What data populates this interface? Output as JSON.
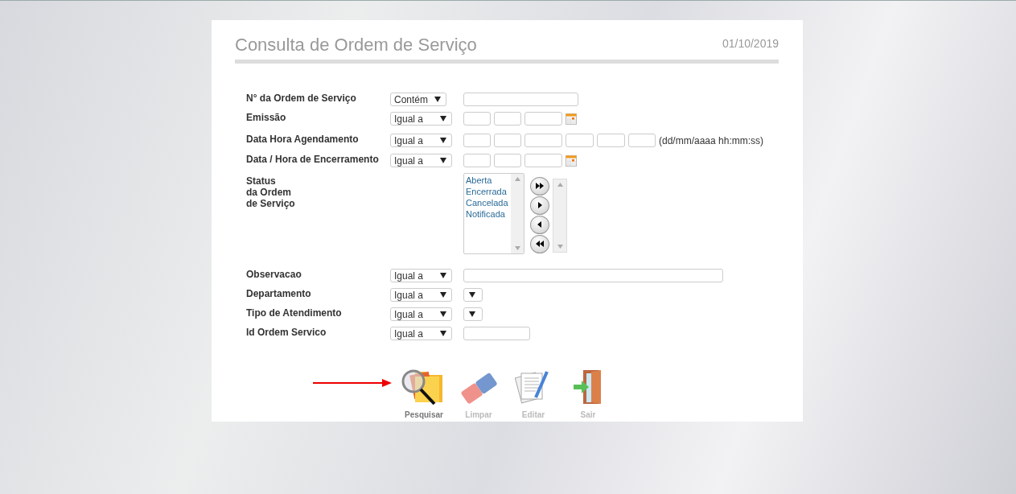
{
  "page": {
    "title": "Consulta de Ordem de Serviço",
    "date": "01/10/2019"
  },
  "fields": [
    {
      "label": "N° da Ordem de Serviço",
      "operator": "Contém",
      "kind": "text"
    },
    {
      "label": "Emissão",
      "operator": "Igual a",
      "kind": "date"
    },
    {
      "label": "Data Hora Agendamento",
      "operator": "Igual a",
      "kind": "datetime",
      "hint": "(dd/mm/aaaa hh:mm:ss)"
    },
    {
      "label": "Data / Hora de Encerramento",
      "operator": "Igual a",
      "kind": "date"
    },
    {
      "label": "Status\nda Ordem\nde Serviço",
      "kind": "listbox",
      "options": [
        "Aberta",
        "Encerrada",
        "Cancelada",
        "Notificada"
      ]
    },
    {
      "label": "Observacao",
      "operator": "Igual a",
      "kind": "long-text"
    },
    {
      "label": "Departamento",
      "operator": "Igual a",
      "kind": "dropdown"
    },
    {
      "label": "Tipo de Atendimento",
      "operator": "Igual a",
      "kind": "dropdown"
    },
    {
      "label": "Id Ordem Servico",
      "operator": "Igual a",
      "kind": "short-text"
    }
  ],
  "actions": [
    {
      "label": "Pesquisar",
      "disabled": false
    },
    {
      "label": "Limpar",
      "disabled": true
    },
    {
      "label": "Editar",
      "disabled": true
    },
    {
      "label": "Sair",
      "disabled": true
    }
  ]
}
